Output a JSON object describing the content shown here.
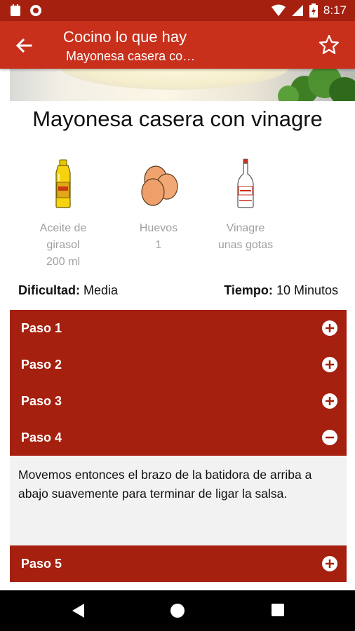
{
  "status_bar": {
    "time": "8:17"
  },
  "app_bar": {
    "title": "Cocino lo que hay",
    "subtitle": "Mayonesa casera co…"
  },
  "recipe": {
    "title": "Mayonesa casera con vinagre",
    "ingredients": [
      {
        "name": "Aceite de girasol",
        "line1": "Aceite de",
        "line2": "girasol",
        "qty": "200 ml",
        "icon": "oil-bottle-icon"
      },
      {
        "name": "Huevos",
        "line1": "Huevos",
        "qty": "1",
        "icon": "eggs-icon"
      },
      {
        "name": "Vinagre",
        "line1": "Vinagre",
        "qty": "unas gotas",
        "icon": "vinegar-bottle-icon"
      }
    ],
    "difficulty_label": "Dificultad:",
    "difficulty_value": "Media",
    "time_label": "Tiempo:",
    "time_value": "10 Minutos"
  },
  "steps": [
    {
      "label": "Paso 1",
      "expanded": false
    },
    {
      "label": "Paso 2",
      "expanded": false
    },
    {
      "label": "Paso 3",
      "expanded": false
    },
    {
      "label": "Paso 4",
      "expanded": true,
      "text": "Movemos entonces el brazo de la batidora de arriba a abajo suavemente para terminar de ligar la salsa."
    },
    {
      "label": "Paso 5",
      "expanded": false
    }
  ],
  "colors": {
    "status_bar": "#a5200f",
    "app_bar": "#c8301c",
    "step_header": "#a5200f",
    "step_body": "#f2f2f2"
  }
}
